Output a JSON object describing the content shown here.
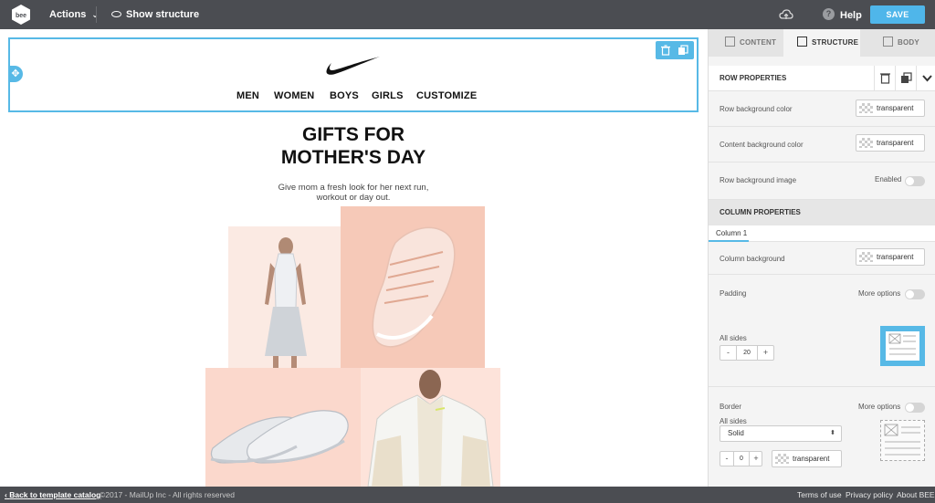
{
  "topbar": {
    "logo_text": "bee",
    "actions_label": "Actions",
    "show_structure_label": "Show structure",
    "help_label": "Help",
    "save_label": "SAVE"
  },
  "email": {
    "nav": [
      "MEN",
      "WOMEN",
      "BOYS",
      "GIRLS",
      "CUSTOMIZE"
    ],
    "title_line1": "GIFTS FOR",
    "title_line2": "MOTHER'S DAY",
    "subtitle_line1": "Give mom a fresh look for her next run,",
    "subtitle_line2": "workout or day out.",
    "brand_color": "#111111",
    "selection_color": "#57b9e6"
  },
  "panel": {
    "tabs": [
      "CONTENT",
      "STRUCTURE",
      "BODY"
    ],
    "active_tab": "STRUCTURE",
    "row_properties": {
      "heading": "ROW PROPERTIES",
      "row_bg_label": "Row background color",
      "row_bg_value": "transparent",
      "content_bg_label": "Content background color",
      "content_bg_value": "transparent",
      "row_bg_image_label": "Row background image",
      "row_bg_image_toggle_label": "Enabled"
    },
    "column_properties": {
      "heading": "COLUMN PROPERTIES",
      "column_tab": "Column 1",
      "column_bg_label": "Column background",
      "column_bg_value": "transparent",
      "padding_label": "Padding",
      "padding_more_options": "More options",
      "all_sides_label": "All sides",
      "padding_value": "20",
      "border_label": "Border",
      "border_more_options": "More options",
      "border_all_sides_label": "All sides",
      "border_style": "Solid",
      "border_width": "0",
      "border_color": "transparent",
      "minus": "-",
      "plus": "+"
    }
  },
  "footer": {
    "back_label": "Back to template catalog",
    "copyright": "©2017 - MailUp Inc - All rights reserved",
    "links": [
      "Terms of use",
      "Privacy policy",
      "About BEE"
    ]
  }
}
